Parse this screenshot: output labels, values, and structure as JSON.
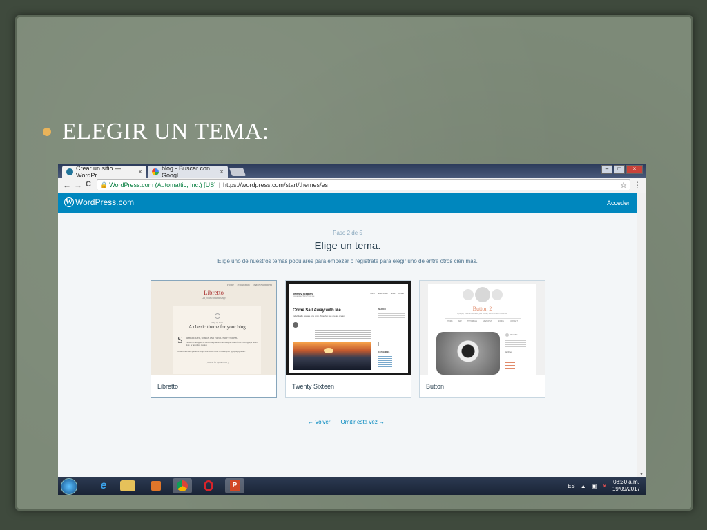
{
  "slide": {
    "title": "ELEGIR UN TEMA:"
  },
  "browser": {
    "tabs": [
      {
        "label": "Crear un sitio — WordPr",
        "close": "×"
      },
      {
        "label": "blog - Buscar con Googl",
        "close": "×"
      }
    ],
    "window_buttons": {
      "minimize": "–",
      "maximize": "□",
      "close": "×"
    },
    "nav": {
      "back": "←",
      "forward": "→",
      "reload": "C"
    },
    "url": {
      "secure_label": "WordPress.com (Automattic, Inc.) [US]",
      "separator": "|",
      "address": "https://wordpress.com/start/themes/es"
    },
    "star": "☆",
    "menu": "⋮"
  },
  "wp": {
    "logo_glyph": "W",
    "brand": "WordPress.com",
    "login": "Acceder",
    "step": "Paso 2 de 5",
    "heading": "Elige un tema.",
    "subheading": "Elige uno de nuestros temas populares para empezar o regístrate para elegir uno de entre otros cien más.",
    "themes": [
      {
        "name": "Libretto"
      },
      {
        "name": "Twenty Sixteen"
      },
      {
        "name": "Button"
      }
    ],
    "back_arrow": "←",
    "back": "Volver",
    "skip": "Omitir esta vez",
    "skip_arrow": "→"
  },
  "thumbs": {
    "libretto": {
      "menu": [
        "Home",
        "Typography",
        "Image Alignment"
      ],
      "title": "Libretto",
      "tagline": "Let your content sing!",
      "date": "May 18, 2016",
      "post_title": "A classic theme for your blog",
      "drop_cap": "S",
      "body_lead": "OPHISTICATED, SIMPLE, AND FLAWLESSLY STYLISH...",
      "body": "Libretto is designed to showcase your text and images. Use it for a travelogue, a photo blog, or an online journal.",
      "body2": "Want to add pull quotes or drop caps? Here's how to make your typography shine.",
      "more": "[ read on for tips & tricks ]"
    },
    "twentysixteen": {
      "site": "Twenty Sixteen",
      "tagline": "Just another WordPress site",
      "menu": [
        "Home",
        "Beside a Star",
        "About",
        "Contact"
      ],
      "post_title": "Come Sail Away with Me",
      "excerpt": "Individually, we are one drop. Together, we are an ocean.",
      "sidebar_search": "SEARCH",
      "sidebar_categories": "CATEGORIES"
    },
    "button": {
      "title": "Button 2",
      "tagline": "A playful, minimal theme for your stories, sketches and memories.",
      "menu": [
        "HOME",
        "ART",
        "TUTORIALS",
        "SKETCHES",
        "BOOKS",
        "CONTACT"
      ],
      "widget_about": "About Me",
      "widget_archive": "Archives"
    }
  },
  "taskbar": {
    "lang": "ES",
    "time": "08:30 a.m.",
    "date": "19/09/2017"
  },
  "colors": {
    "wp_blue": "#0087be",
    "bullet": "#e9b35a",
    "text_dark": "#2e4453"
  }
}
